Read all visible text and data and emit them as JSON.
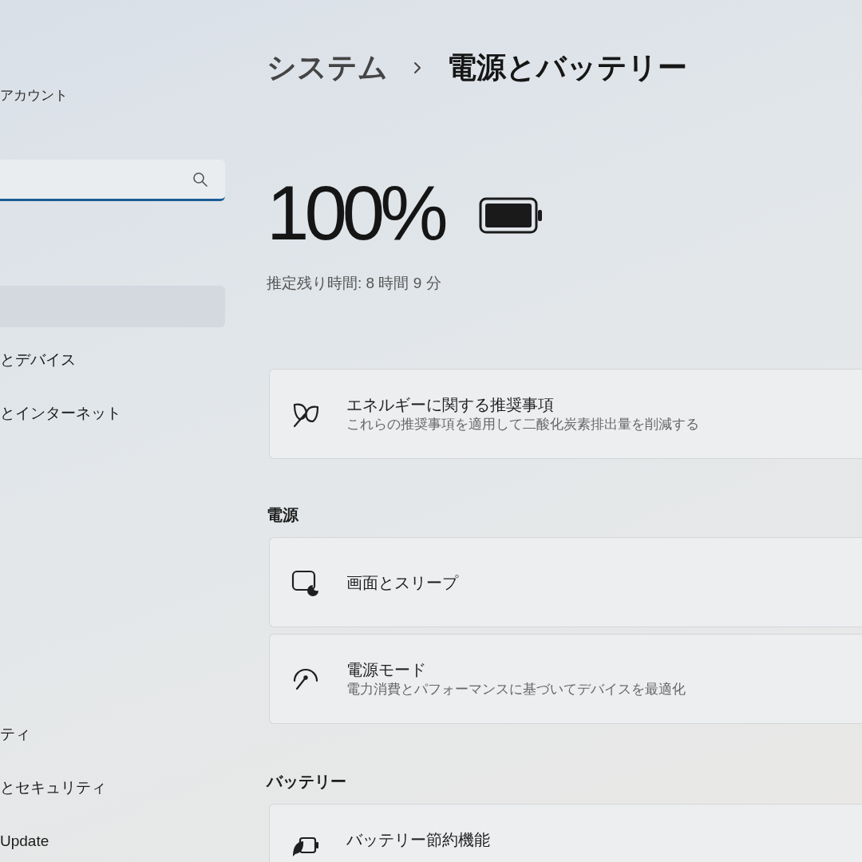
{
  "sidebar": {
    "account": "アカウント",
    "search": {
      "focused": true
    },
    "items": [
      {
        "selected": true
      },
      {
        "label": "とデバイス",
        "selected": false
      },
      {
        "label": "とインターネット",
        "selected": false
      },
      {
        "label": "ティ",
        "selected": false
      },
      {
        "label": "とセキュリティ",
        "selected": false
      },
      {
        "label": "Update",
        "selected": false
      }
    ]
  },
  "header": {
    "parent": "システム",
    "current": "電源とバッテリー"
  },
  "battery": {
    "percent": "100%",
    "level": 1,
    "estimate": "推定残り時間: 8 時間 9 分"
  },
  "recommendation": {
    "kind": "energy",
    "title": "エネルギーに関する推奨事項",
    "subtitle": "これらの推奨事項を適用して二酸化炭素排出量を削減する"
  },
  "sections": [
    {
      "heading": "電源",
      "cards": [
        {
          "kind": "screen",
          "title": "画面とスリープ"
        },
        {
          "kind": "power_mode",
          "title": "電源モード",
          "subtitle": "電力消費とパフォーマンスに基づいてデバイスを最適化"
        }
      ]
    },
    {
      "heading": "バッテリー",
      "cards": [
        {
          "kind": "saver",
          "title": "バッテリー節約機能"
        }
      ]
    }
  ]
}
